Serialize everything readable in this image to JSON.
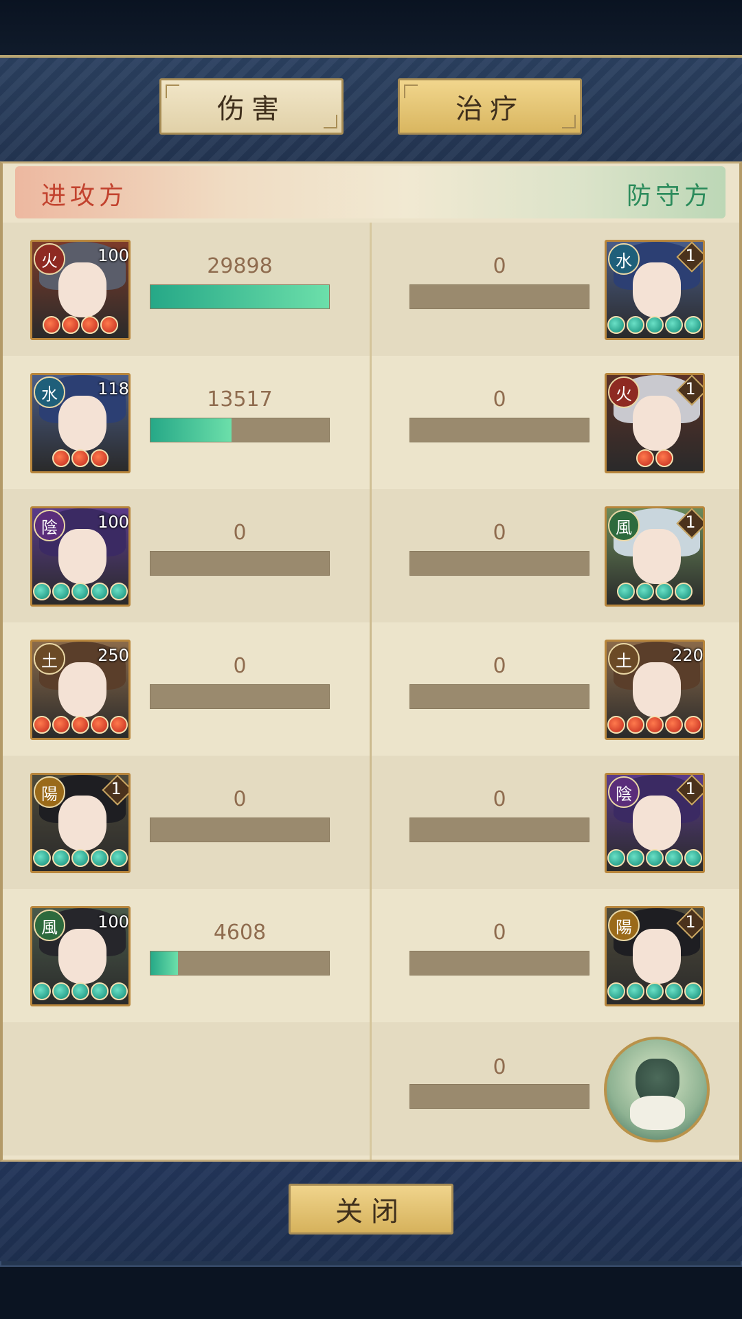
{
  "tabs": {
    "damage": "伤害",
    "heal": "治疗"
  },
  "header": {
    "attacker": "进攻方",
    "defender": "防守方"
  },
  "rows": [
    {
      "attacker": {
        "element": "火",
        "element_color": "#8e2a22",
        "level": "100",
        "stars": 4,
        "star_color": "red",
        "hair": "#5a5d6a",
        "bg": "#7c3b2a",
        "value": "29898",
        "fill": 1.0
      },
      "defender": {
        "element": "水",
        "element_color": "#1f5f7a",
        "level": "1",
        "stars": 5,
        "star_color": "green",
        "hair": "#2c3f73",
        "bg": "#4a5d88",
        "value": "0",
        "fill": 0
      }
    },
    {
      "attacker": {
        "element": "水",
        "element_color": "#1f5f7a",
        "level": "118",
        "stars": 3,
        "star_color": "red",
        "hair": "#2c3f73",
        "bg": "#4a5d88",
        "value": "13517",
        "fill": 0.452
      },
      "defender": {
        "element": "火",
        "element_color": "#8e2a22",
        "level": "1",
        "stars": 2,
        "star_color": "red",
        "hair": "#c9c9cf",
        "bg": "#5b3127",
        "value": "0",
        "fill": 0
      }
    },
    {
      "attacker": {
        "element": "陰",
        "element_color": "#5a2d7a",
        "level": "100",
        "stars": 5,
        "star_color": "green",
        "hair": "#3b2a63",
        "bg": "#5a3b8a",
        "value": "0",
        "fill": 0
      },
      "defender": {
        "element": "風",
        "element_color": "#2d6a3d",
        "level": "1",
        "stars": 4,
        "star_color": "green",
        "hair": "#c9d6dd",
        "bg": "#6a8a5a",
        "value": "0",
        "fill": 0
      }
    },
    {
      "attacker": {
        "element": "土",
        "element_color": "#6b4a26",
        "level": "250",
        "stars": 5,
        "star_color": "red",
        "hair": "#5a3e2a",
        "bg": "#8a6a4a",
        "value": "0",
        "fill": 0
      },
      "defender": {
        "element": "土",
        "element_color": "#6b4a26",
        "level": "220",
        "stars": 5,
        "star_color": "red",
        "hair": "#5a3e2a",
        "bg": "#8a6a4a",
        "value": "0",
        "fill": 0
      }
    },
    {
      "attacker": {
        "element": "陽",
        "element_color": "#9a6a1a",
        "level": "1",
        "stars": 5,
        "star_color": "green",
        "hair": "#1e1e22",
        "bg": "#4e4a3a",
        "value": "0",
        "fill": 0
      },
      "defender": {
        "element": "陰",
        "element_color": "#5a2d7a",
        "level": "1",
        "stars": 5,
        "star_color": "green",
        "hair": "#3b2a63",
        "bg": "#5a3b8a",
        "value": "0",
        "fill": 0
      }
    },
    {
      "attacker": {
        "element": "風",
        "element_color": "#2d6a3d",
        "level": "100",
        "stars": 5,
        "star_color": "green",
        "hair": "#26262b",
        "bg": "#4a5a4a",
        "value": "4608",
        "fill": 0.154
      },
      "defender": {
        "element": "陽",
        "element_color": "#9a6a1a",
        "level": "1",
        "stars": 5,
        "star_color": "green",
        "hair": "#1e1e22",
        "bg": "#4e4a3a",
        "value": "0",
        "fill": 0
      }
    }
  ],
  "beast": {
    "value": "0",
    "fill": 0
  },
  "close_label": "关闭"
}
